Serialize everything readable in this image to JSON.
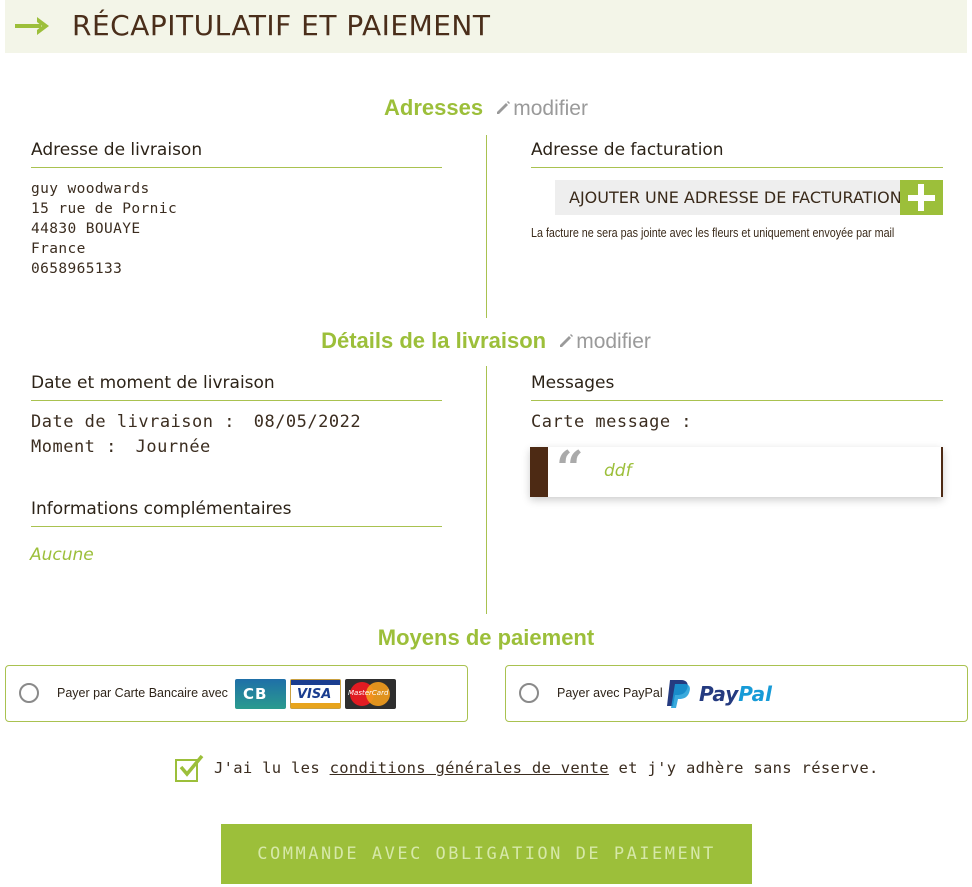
{
  "page": {
    "title": "RÉCAPITULATIF ET PAIEMENT"
  },
  "addresses": {
    "title": "Adresses",
    "modify": "modifier",
    "delivery": {
      "heading": "Adresse de livraison",
      "lines": [
        "guy woodwards",
        "15 rue de Pornic",
        "44830 BOUAYE",
        "France",
        "0658965133"
      ]
    },
    "billing": {
      "heading": "Adresse de facturation",
      "add_button": "AJOUTER UNE ADRESSE DE FACTURATION",
      "note": "La facture ne sera pas jointe avec les fleurs et uniquement envoyée par mail"
    }
  },
  "delivery_details": {
    "title": "Détails de la livraison",
    "modify": "modifier",
    "date_heading": "Date et moment de livraison",
    "date_label": "Date de livraison :",
    "date_value": "08/05/2022",
    "moment_label": "Moment :",
    "moment_value": "Journée",
    "info_heading": "Informations complémentaires",
    "info_value": "Aucune",
    "messages_heading": "Messages",
    "card_message_label": "Carte message :",
    "card_message_value": "ddf"
  },
  "payment": {
    "title": "Moyens de paiement",
    "card_option": "Payer par Carte Bancaire avec",
    "card_logos": {
      "cb": "CB",
      "visa": "VISA",
      "mastercard": "MasterCard"
    },
    "paypal_option": "Payer avec PayPal",
    "paypal_logo": {
      "part1": "Pay",
      "part2": "Pal"
    }
  },
  "terms": {
    "prefix": "J'ai lu les ",
    "link": "conditions générales de vente",
    "suffix": " et j'y adhère sans réserve.",
    "checked": true
  },
  "submit": {
    "label": "COMMANDE AVEC OBLIGATION DE PAIEMENT"
  },
  "colors": {
    "accent": "#9cbf3a",
    "brown": "#4d2a14",
    "header_bg": "#f3f5e8"
  }
}
